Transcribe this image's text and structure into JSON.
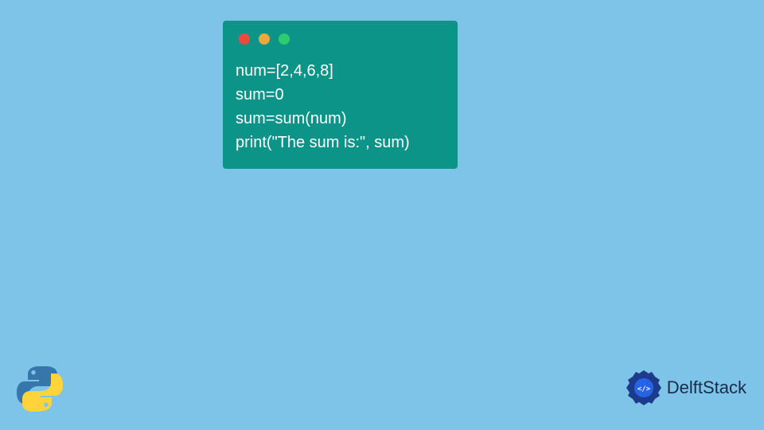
{
  "code": {
    "lines": [
      "num=[2,4,6,8]",
      "sum=0",
      "sum=sum(num)",
      "print(\"The sum is:\", sum)"
    ]
  },
  "branding": {
    "delftstack_text": "DelftStack"
  }
}
